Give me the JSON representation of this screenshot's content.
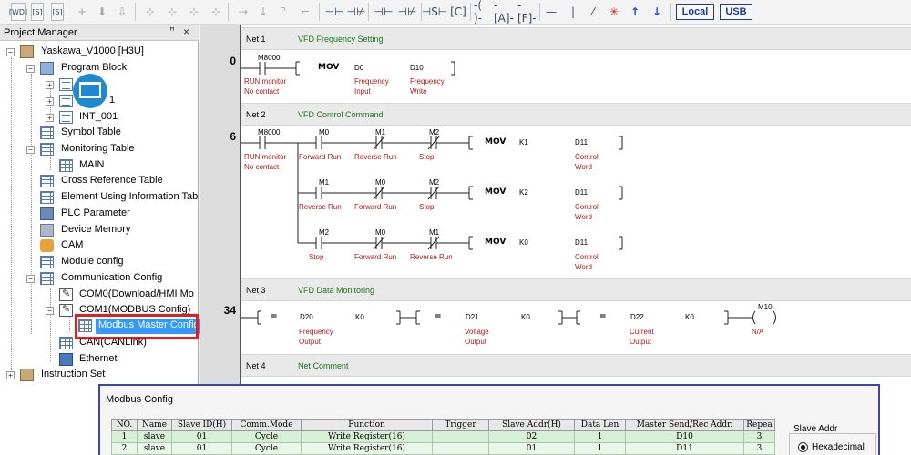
{
  "toolbar": {
    "box_icons": [
      "[WD]",
      "[S]",
      "[S]"
    ],
    "buttons": [
      "Local",
      "USB"
    ]
  },
  "project_manager": {
    "title": "Project Manager",
    "pin_glyph": "ꟸ",
    "close_glyph": "×",
    "root": "Yaskawa_V1000 [H3U]",
    "items": {
      "program_block": "Program Block",
      "sub_1": "1",
      "int_001": "INT_001",
      "symbol_table": "Symbol Table",
      "monitoring_table": "Monitoring Table",
      "main": "MAIN",
      "cross_ref": "Cross Reference Table",
      "element_info": "Element Using Information Tab",
      "plc_param": "PLC Parameter",
      "device_memory": "Device Memory",
      "cam": "CAM",
      "module_config": "Module config",
      "comm_config": "Communication Config",
      "com0": "COM0(Download/HMI Mo",
      "com1": "COM1(MODBUS Config)",
      "modbus_master": "Modbus Master Config",
      "can": "CAN(CANLink)",
      "ethernet": "Ethernet",
      "instruction_set": "Instruction Set"
    }
  },
  "ladder": {
    "net1": {
      "label": "Net 1",
      "comment": "VFD Frequency Setting",
      "step": "0",
      "contact": "M8000",
      "contact_c1": "RUN monitor",
      "contact_c2": "No contact",
      "op": "MOV",
      "src": "D0",
      "src_c1": "Frequency",
      "src_c2": "Input",
      "dst": "D10",
      "dst_c1": "Frequency",
      "dst_c2": "Write"
    },
    "net2": {
      "label": "Net 2",
      "comment": "VFD Control Command",
      "step": "6",
      "m8000": "M8000",
      "m8000_c1": "RUN monitor",
      "m8000_c2": "No contact",
      "row1": {
        "c1": "M0",
        "c1d": "Forward Run",
        "c2": "M1",
        "c2d": "Reverse Run",
        "c3": "M2",
        "c3d": "Stop",
        "op": "MOV",
        "src": "K1",
        "dst": "D11",
        "dst_c1": "Control",
        "dst_c2": "Word"
      },
      "row2": {
        "c1": "M1",
        "c1d": "Reverse Run",
        "c2": "M0",
        "c2d": "Forward Run",
        "c3": "M2",
        "c3d": "Stop",
        "op": "MOV",
        "src": "K2",
        "dst": "D11",
        "dst_c1": "Control",
        "dst_c2": "Word"
      },
      "row3": {
        "c1": "M2",
        "c1d": "Stop",
        "c2": "M0",
        "c2d": "Forward Run",
        "c3": "M1",
        "c3d": "Reverse Run",
        "op": "MOV",
        "src": "K0",
        "dst": "D11",
        "dst_c1": "Control",
        "dst_c2": "Word"
      }
    },
    "net3": {
      "label": "Net 3",
      "comment": "VFD Data Monitoring",
      "step": "34",
      "cmp1": {
        "op": "=",
        "a": "D20",
        "b": "K0",
        "c1": "Frequency",
        "c2": "Output"
      },
      "cmp2": {
        "op": "=",
        "a": "D21",
        "b": "K0",
        "c1": "Voltage",
        "c2": "Output"
      },
      "cmp3": {
        "op": "=",
        "a": "D22",
        "b": "K0",
        "c1": "Current",
        "c2": "Output"
      },
      "coil": "M10",
      "coil_c": "N/A"
    },
    "net4": {
      "label": "Net 4",
      "comment": "Net Comment"
    }
  },
  "modbus_config": {
    "title": "Modbus Config",
    "columns": [
      "NO.",
      "Name",
      "Slave ID(H)",
      "Comm.Mode",
      "Function",
      "Trigger",
      "Slave Addr(H)",
      "Data Len",
      "Master Send/Rec Addr.",
      "Repea"
    ],
    "rows": [
      [
        "1",
        "slave",
        "01",
        "Cycle",
        "Write Register(16)",
        "",
        "02",
        "1",
        "D10",
        "3"
      ],
      [
        "2",
        "slave",
        "01",
        "Cycle",
        "Write Register(16)",
        "",
        "01",
        "1",
        "D11",
        "3"
      ]
    ],
    "slave_addr_group": "Slave Addr",
    "hex_option": "Hexadecimal"
  }
}
